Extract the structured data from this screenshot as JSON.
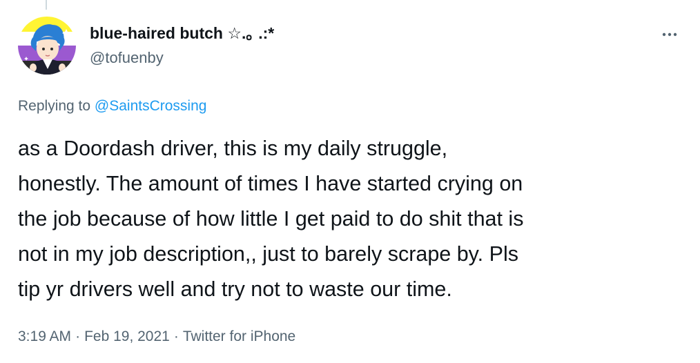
{
  "tweet": {
    "author": {
      "display_name": "blue-haired butch ☆.｡ .:*",
      "handle": "@tofuenby",
      "avatar_icon": "profile-illustration-avatar"
    },
    "reply_context": {
      "prefix": "Replying to",
      "mention": "@SaintsCrossing"
    },
    "text_lines": [
      "as a Doordash driver, this is my daily struggle,",
      "honestly. The amount of times I have started crying on",
      "the job because of how little I get paid to do shit that is",
      "not in my job description,, just to barely scrape by. Pls",
      "tip yr drivers well and try not to waste our time."
    ],
    "meta": {
      "time": "3:19 AM",
      "separator": "·",
      "date": "Feb 19, 2021",
      "source": "Twitter for iPhone"
    },
    "more_icon": "more-horizontal-icon"
  },
  "colors": {
    "text_primary": "#0f1419",
    "text_secondary": "#536471",
    "link": "#1d9bf0",
    "thread_line": "#cfd9de"
  }
}
